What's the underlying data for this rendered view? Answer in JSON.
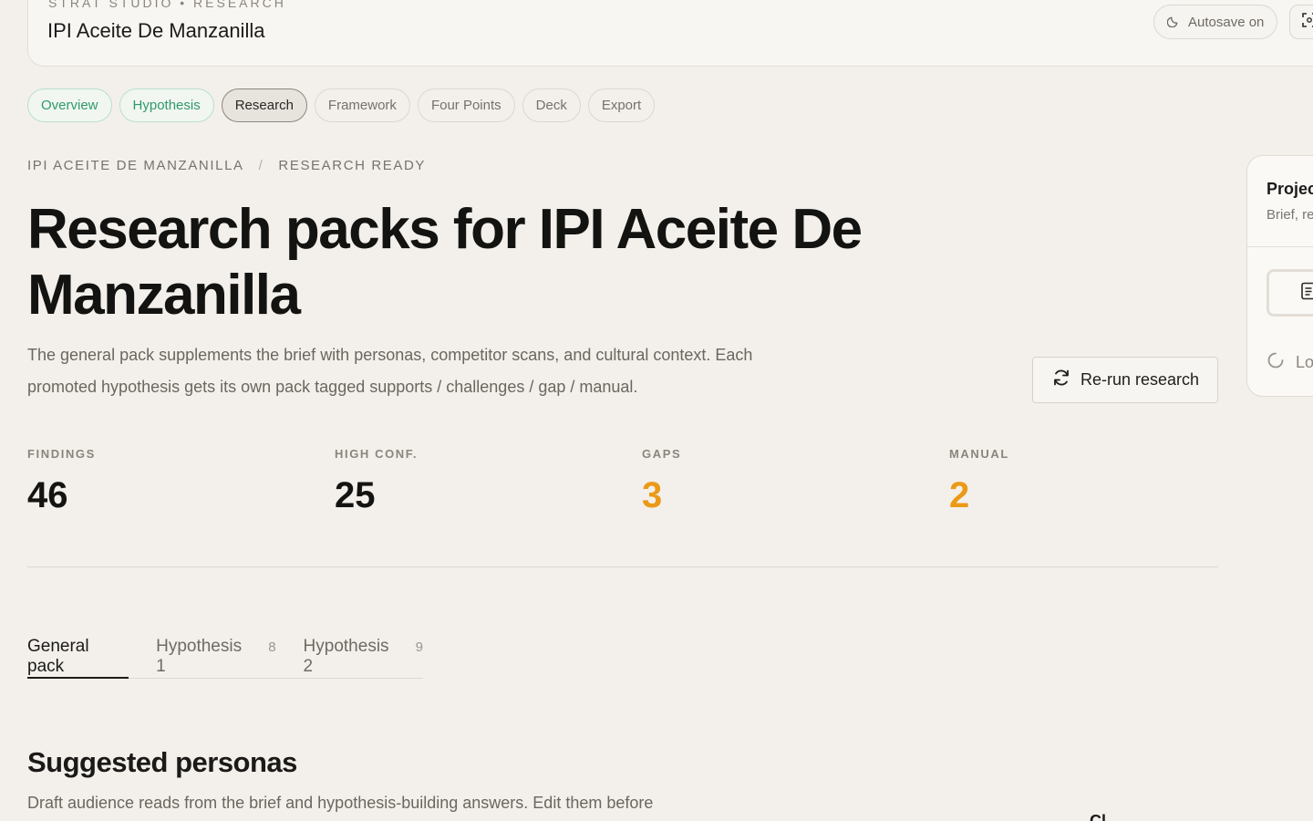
{
  "topbar": {
    "eyebrow": "STRAT STUDIO  •  RESEARCH",
    "title": "IPI Aceite De Manzanilla",
    "autosave": "Autosave on",
    "autosave_icon": "moon-icon",
    "expand_icon": "expand-icon"
  },
  "tabs": [
    {
      "label": "Overview",
      "state": "done"
    },
    {
      "label": "Hypothesis",
      "state": "done"
    },
    {
      "label": "Research",
      "state": "active"
    },
    {
      "label": "Framework",
      "state": "pending"
    },
    {
      "label": "Four Points",
      "state": "pending"
    },
    {
      "label": "Deck",
      "state": "pending"
    },
    {
      "label": "Export",
      "state": "pending"
    }
  ],
  "breadcrumb": {
    "project": "IPI ACEITE DE MANZANILLA",
    "separator": "/",
    "status": "RESEARCH READY"
  },
  "heading": "Research packs for IPI Aceite De Manzanilla",
  "description": "The general pack supplements the brief with personas, competitor scans, and cultural context. Each promoted hypothesis gets its own pack tagged supports / challenges / gap / manual.",
  "rerun_button": {
    "label": "Re-run research",
    "icon": "refresh-icon"
  },
  "stats": [
    {
      "label": "FINDINGS",
      "value": "46",
      "tone": "normal"
    },
    {
      "label": "HIGH CONF.",
      "value": "25",
      "tone": "normal"
    },
    {
      "label": "GAPS",
      "value": "3",
      "tone": "warn"
    },
    {
      "label": "MANUAL",
      "value": "2",
      "tone": "warn"
    }
  ],
  "pack_tabs": [
    {
      "label": "General pack",
      "count": ""
    },
    {
      "label": "Hypothesis 1",
      "count": "8"
    },
    {
      "label": "Hypothesis 2",
      "count": "9"
    }
  ],
  "section": {
    "title": "Suggested personas",
    "description": "Draft audience reads from the brief and hypothesis-building answers. Edit them before"
  },
  "side_panel": {
    "title": "Projec",
    "subtitle": "Brief, re",
    "doc_icon": "document-icon",
    "loading": "Lo",
    "loading_icon": "spinner-icon"
  },
  "cut_text": "Cl",
  "colors": {
    "background": "#f3f0eb",
    "accent_green": "#2f9a6a",
    "warn_orange": "#eb9a18",
    "text": "#131311"
  }
}
